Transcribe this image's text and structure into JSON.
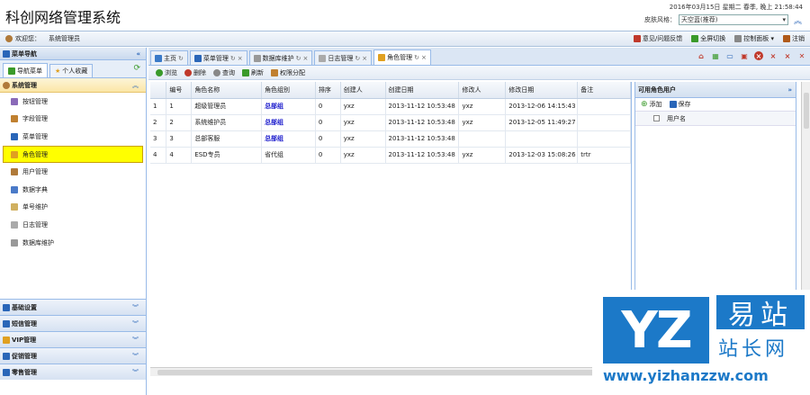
{
  "header": {
    "title": "科创网络管理系统",
    "datetime": "2016年03月15日 星期二 春季, 晚上 21:58:44",
    "skin_label": "皮肤风格：",
    "skin_value": "天空蓝(推荐)"
  },
  "topbar": {
    "welcome": "欢迎您：",
    "user": "系统管理员",
    "links": [
      "意见/问题反馈",
      "全屏切换",
      "控制面板 ▾",
      "注销"
    ]
  },
  "sidebar": {
    "title": "菜单导航",
    "tabs": [
      "导航菜单",
      "个人收藏"
    ],
    "section": "系统管理",
    "items": [
      "按钮管理",
      "字段管理",
      "菜单管理",
      "角色管理",
      "用户管理",
      "数据字典",
      "单号维护",
      "日志管理",
      "数据库维护"
    ],
    "groups": [
      "基础设置",
      "短信管理",
      "VIP管理",
      "促销管理",
      "零售管理"
    ]
  },
  "main": {
    "tabs": [
      "主页",
      "菜单管理",
      "数据库维护",
      "日志管理",
      "角色管理"
    ],
    "toolbar": [
      "浏览",
      "删除",
      "查询",
      "刷新",
      "权限分配"
    ],
    "columns": [
      "编号",
      "角色名称",
      "角色组别",
      "排序",
      "创建人",
      "创建日期",
      "修改人",
      "修改日期",
      "备注"
    ],
    "rows": [
      [
        "1",
        "超级管理员",
        "总部组",
        "0",
        "yxz",
        "2013-11-12 10:53:48",
        "yxz",
        "2013-12-06 14:15:43",
        ""
      ],
      [
        "2",
        "系统维护员",
        "总部组",
        "0",
        "yxz",
        "2013-11-12 10:53:48",
        "yxz",
        "2013-12-05 11:49:27",
        ""
      ],
      [
        "3",
        "总部客服",
        "总部组",
        "0",
        "yxz",
        "2013-11-12 10:53:48",
        "",
        "",
        " "
      ],
      [
        "4",
        "ESD专员",
        "省代组",
        "0",
        "yxz",
        "2013-11-12 10:53:48",
        "yxz",
        "2013-12-03 15:08:26",
        "trtr"
      ]
    ]
  },
  "right_panel": {
    "title": "可用角色用户",
    "add": "添加",
    "save": "保存",
    "col": "用户名"
  },
  "watermark": {
    "box": "YZ",
    "brand": "易站",
    "sub": "站长网",
    "url": "www.yizhanzzw.com"
  }
}
